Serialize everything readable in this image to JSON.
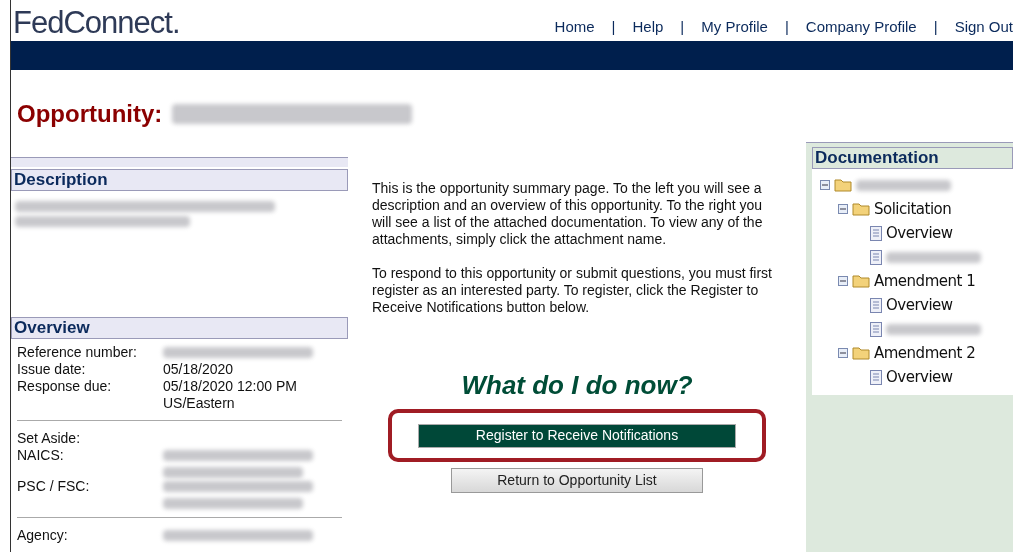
{
  "header": {
    "logo": "FedConnect.",
    "nav": [
      {
        "kind": "link",
        "label": "Home"
      },
      {
        "kind": "separator",
        "label": "|"
      },
      {
        "kind": "link",
        "label": "Help"
      },
      {
        "kind": "separator",
        "label": "|"
      },
      {
        "kind": "link",
        "label": "My Profile"
      },
      {
        "kind": "separator",
        "label": "|"
      },
      {
        "kind": "link",
        "label": "Company Profile"
      },
      {
        "kind": "separator",
        "label": "|"
      },
      {
        "kind": "link",
        "label": "Sign Out"
      }
    ]
  },
  "page_title": {
    "label": "Opportunity:",
    "value_redacted": true
  },
  "description": {
    "title": "Description",
    "redacted": true
  },
  "overview": {
    "title": "Overview",
    "groups": [
      [
        {
          "label": "Reference number:",
          "redacted": true
        },
        {
          "label": "Issue date:",
          "value": "05/18/2020"
        },
        {
          "label": "Response due:",
          "value": "05/18/2020 12:00 PM US/Eastern"
        }
      ],
      [
        {
          "label": "Set Aside:"
        },
        {
          "label": "NAICS:",
          "redacted": true
        },
        {
          "label": "PSC / FSC:",
          "redacted": true
        }
      ],
      [
        {
          "label": "Agency:",
          "redacted": true
        }
      ]
    ]
  },
  "intro": [
    "This is the opportunity summary page. To the left you will see a description and an overview of this opportunity. To the right you will see a list of the attached documentation. To view any of the attachments, simply click the attachment name.",
    "To respond to this opportunity or submit questions, you must first register as an interested party. To register, click the Register to Receive Notifications button below."
  ],
  "prompt": "What do I do now?",
  "buttons": [
    {
      "label": "Register to Receive Notifications",
      "kind": "primary",
      "highlighted": true
    },
    {
      "label": "Return to Opportunity List",
      "kind": "secondary",
      "highlighted": false
    }
  ],
  "documentation": {
    "title": "Documentation",
    "tree": [
      {
        "kind": "folder",
        "expanded": true,
        "children": [
          {
            "kind": "folder",
            "label": "Solicitation",
            "expanded": true,
            "children": [
              {
                "kind": "document",
                "label": "Overview"
              },
              {
                "kind": "document"
              }
            ]
          },
          {
            "kind": "folder",
            "label": "Amendment 1",
            "expanded": true,
            "children": [
              {
                "kind": "document",
                "label": "Overview"
              },
              {
                "kind": "document"
              }
            ]
          },
          {
            "kind": "folder",
            "label": "Amendment 2",
            "expanded": true,
            "children": [
              {
                "kind": "document",
                "label": "Overview"
              }
            ]
          }
        ]
      }
    ]
  }
}
